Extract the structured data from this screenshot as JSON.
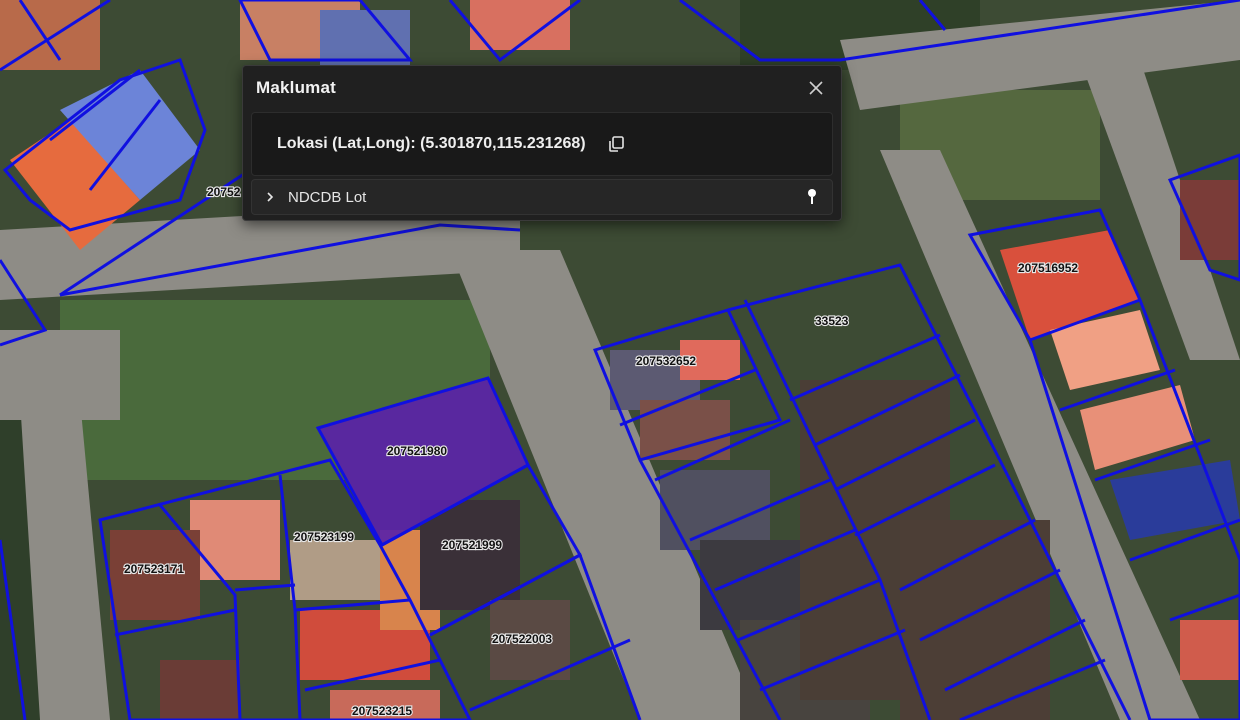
{
  "panel": {
    "title": "Maklumat",
    "location_label": "Lokasi (Lat,Long): (5.301870,115.231268)",
    "layer_row_label": "NDCDB Lot"
  },
  "map": {
    "parcel_outline_color": "#1010e0",
    "selected_fill_color": "#5a23a8",
    "lot_labels": {
      "a": "20752",
      "b": "207516952",
      "c": "33523",
      "d": "207532652",
      "e": "207521980",
      "f": "207523199",
      "g": "207521999",
      "h": "207523171",
      "i": "207522003",
      "j": "207523215"
    }
  }
}
